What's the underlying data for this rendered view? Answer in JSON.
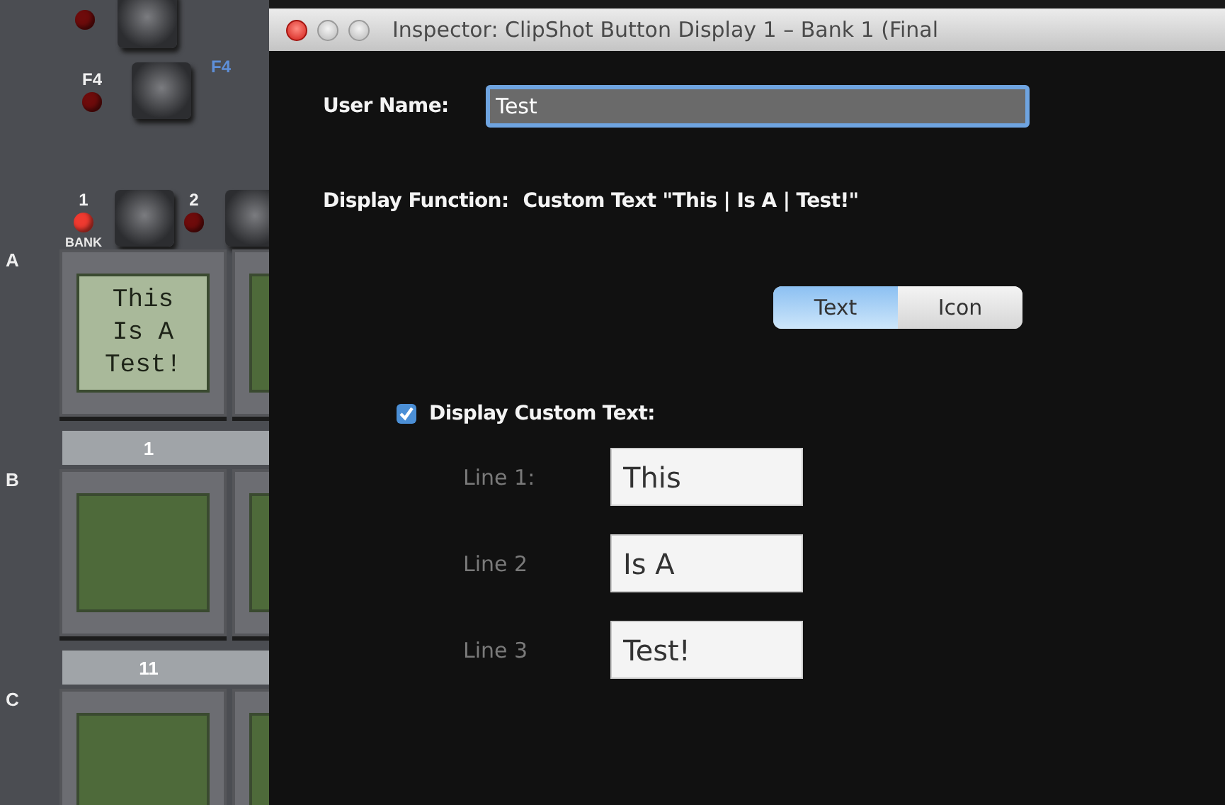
{
  "panel": {
    "f_key": {
      "label": "F4",
      "assigned_label": "F4"
    },
    "bank_caption": "BANK",
    "bank_keys": [
      {
        "number": "1",
        "lit": true
      },
      {
        "number": "2",
        "lit": false
      }
    ],
    "rows": [
      {
        "letter": "A",
        "cells": [
          {
            "kind": "text",
            "lines": [
              "This",
              "Is A",
              "Test!"
            ]
          },
          {
            "kind": "blank"
          }
        ],
        "numbers": [
          "1"
        ]
      },
      {
        "letter": "B",
        "cells": [
          {
            "kind": "blank"
          },
          {
            "kind": "blank"
          }
        ],
        "numbers": [
          "11"
        ]
      },
      {
        "letter": "C",
        "cells": [
          {
            "kind": "blank"
          },
          {
            "kind": "blank"
          }
        ]
      }
    ]
  },
  "inspector": {
    "title": "Inspector: ClipShot Button Display 1 – Bank 1 (Final",
    "user_name": {
      "label": "User Name:",
      "value": "Test"
    },
    "display_function": {
      "label": "Display Function:",
      "value": "Custom Text \"This | Is A | Test!\""
    },
    "mode": [
      {
        "label": "Text",
        "selected": true
      },
      {
        "label": "Icon",
        "selected": false
      }
    ],
    "custom_text": {
      "label": "Display Custom Text:",
      "checked": true
    },
    "lines": [
      {
        "label": "Line 1:",
        "value": "This"
      },
      {
        "label": "Line 2",
        "value": "Is A"
      },
      {
        "label": "Line 3",
        "value": "Test!"
      }
    ]
  }
}
